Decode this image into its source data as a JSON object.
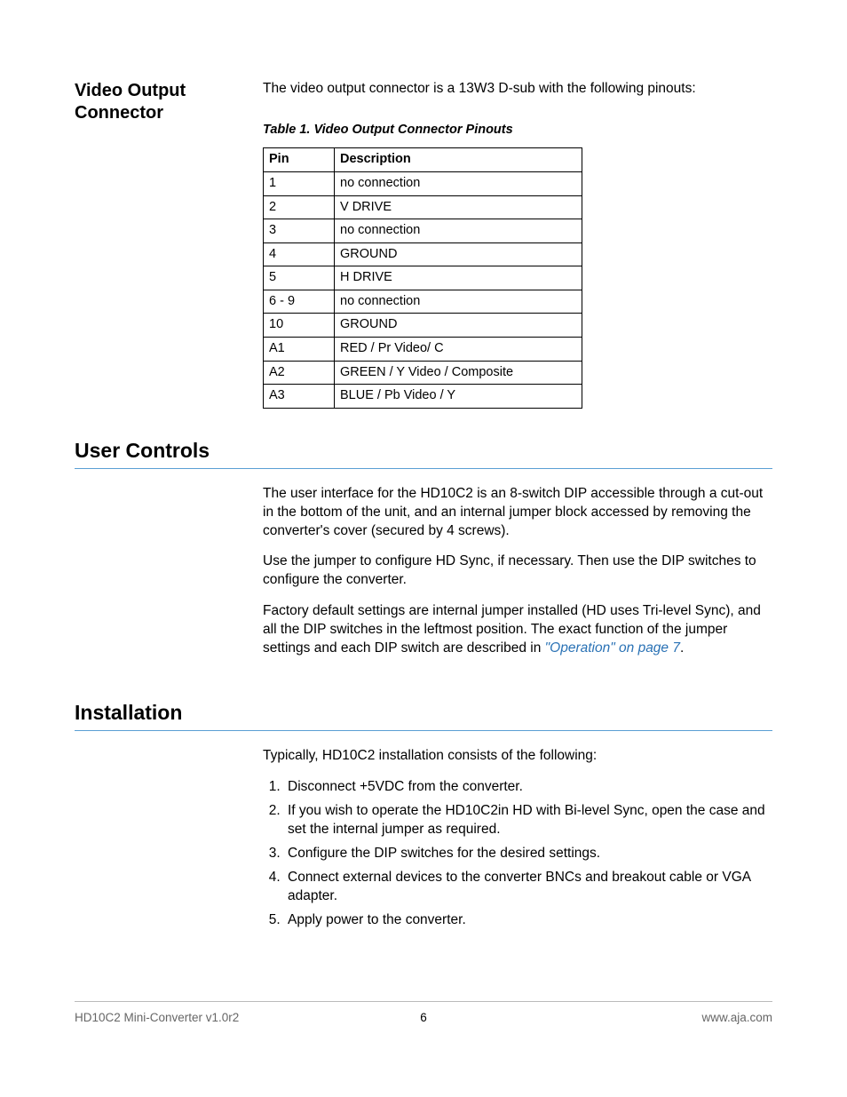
{
  "videoOutput": {
    "heading": "Video Output Connector",
    "intro": "The video output connector is a 13W3 D-sub with the following pinouts:",
    "tableCaption": "Table 1. Video Output Connector Pinouts",
    "thPin": "Pin",
    "thDesc": "Description",
    "rows": [
      {
        "pin": "1",
        "desc": "no connection"
      },
      {
        "pin": "2",
        "desc": "V DRIVE"
      },
      {
        "pin": "3",
        "desc": "no connection"
      },
      {
        "pin": "4",
        "desc": "GROUND"
      },
      {
        "pin": "5",
        "desc": "H DRIVE"
      },
      {
        "pin": "6 - 9",
        "desc": "no connection"
      },
      {
        "pin": "10",
        "desc": "GROUND"
      },
      {
        "pin": "A1",
        "desc": "RED / Pr Video/ C"
      },
      {
        "pin": "A2",
        "desc": "GREEN / Y Video / Composite"
      },
      {
        "pin": "A3",
        "desc": "BLUE / Pb Video / Y"
      }
    ]
  },
  "userControls": {
    "heading": "User Controls",
    "p1": "The user interface for the HD10C2 is an 8-switch DIP accessible through a cut-out in the bottom of the unit, and an internal jumper block accessed by removing the converter's cover (secured by 4 screws).",
    "p2": "Use the jumper to configure HD Sync, if necessary. Then use the DIP switches to configure the converter.",
    "p3a": "Factory default settings are internal jumper installed (HD uses Tri-level Sync), and all the DIP switches in the leftmost position. The exact function of the jumper settings and each DIP switch are described in ",
    "p3link": "\"Operation\" on page 7",
    "p3b": "."
  },
  "installation": {
    "heading": "Installation",
    "intro": "Typically, HD10C2 installation consists of the following:",
    "steps": [
      "Disconnect +5VDC from the converter.",
      "If you wish to operate the HD10C2in HD with Bi-level Sync, open the case and set the internal jumper as required.",
      "Configure the DIP switches for the desired settings.",
      "Connect external devices to the converter BNCs and breakout cable or VGA adapter.",
      "Apply power to the converter."
    ]
  },
  "footer": {
    "left": "HD10C2 Mini-Converter v1.0r2",
    "center": "6",
    "right": "www.aja.com"
  }
}
